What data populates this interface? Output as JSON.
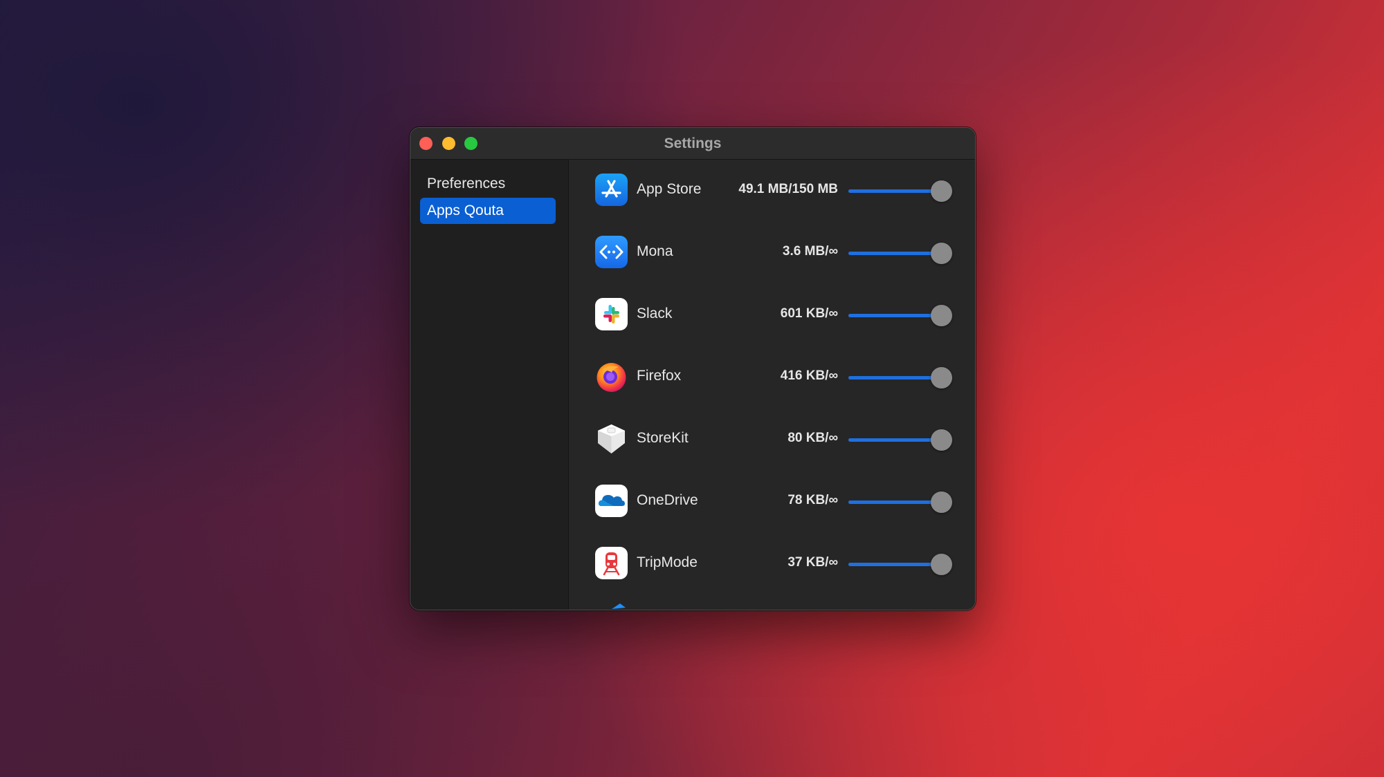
{
  "window": {
    "title": "Settings"
  },
  "sidebar": {
    "items": [
      {
        "label": "Preferences",
        "selected": false
      },
      {
        "label": "Apps Qouta",
        "selected": true
      }
    ]
  },
  "apps": [
    {
      "name": "App Store",
      "usage": "49.1 MB/150 MB",
      "icon": "app-store-icon",
      "slider_fraction": 0.9
    },
    {
      "name": "Mona",
      "usage": "3.6 MB/∞",
      "icon": "mona-icon",
      "slider_fraction": 0.9
    },
    {
      "name": "Slack",
      "usage": "601 KB/∞",
      "icon": "slack-icon",
      "slider_fraction": 0.9
    },
    {
      "name": "Firefox",
      "usage": "416 KB/∞",
      "icon": "firefox-icon",
      "slider_fraction": 0.9
    },
    {
      "name": "StoreKit",
      "usage": "80 KB/∞",
      "icon": "storekit-icon",
      "slider_fraction": 0.9
    },
    {
      "name": "OneDrive",
      "usage": "78 KB/∞",
      "icon": "onedrive-icon",
      "slider_fraction": 0.9
    },
    {
      "name": "TripMode",
      "usage": "37 KB/∞",
      "icon": "tripmode-icon",
      "slider_fraction": 0.9
    }
  ],
  "colors": {
    "accent": "#0a5fd3",
    "slider_fill": "#1f6fe0",
    "close": "#fe5f57",
    "minimize": "#febc2e",
    "maximize": "#28c840"
  }
}
